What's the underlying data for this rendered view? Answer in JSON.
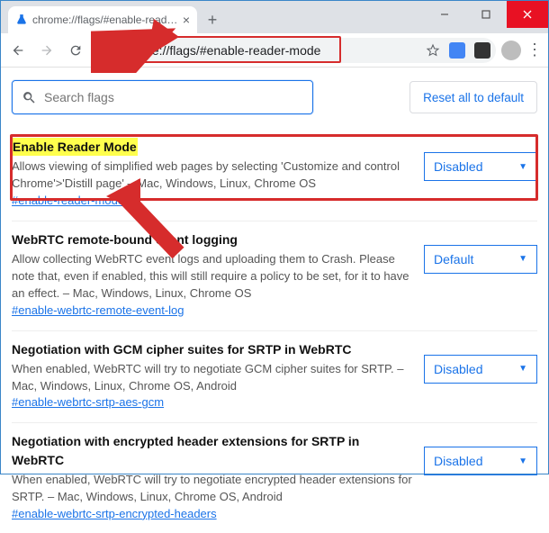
{
  "window": {
    "tab_title": "chrome://flags/#enable-reader-m",
    "url": "chrome://flags/#enable-reader-mode"
  },
  "toolbar": {
    "reset_label": "Reset all to default",
    "search_placeholder": "Search flags"
  },
  "flags": [
    {
      "title": "Enable Reader Mode",
      "highlighted": true,
      "desc": "Allows viewing of simplified web pages by selecting 'Customize and control Chrome'>'Distill page' – Mac, Windows, Linux, Chrome OS",
      "anchor": "#enable-reader-mode",
      "value": "Disabled"
    },
    {
      "title": "WebRTC remote-bound event logging",
      "highlighted": false,
      "desc": "Allow collecting WebRTC event logs and uploading them to Crash. Please note that, even if enabled, this will still require a policy to be set, for it to have an effect. – Mac, Windows, Linux, Chrome OS",
      "anchor": "#enable-webrtc-remote-event-log",
      "value": "Default"
    },
    {
      "title": "Negotiation with GCM cipher suites for SRTP in WebRTC",
      "highlighted": false,
      "desc": "When enabled, WebRTC will try to negotiate GCM cipher suites for SRTP. – Mac, Windows, Linux, Chrome OS, Android",
      "anchor": "#enable-webrtc-srtp-aes-gcm",
      "value": "Disabled"
    },
    {
      "title": "Negotiation with encrypted header extensions for SRTP in WebRTC",
      "highlighted": false,
      "desc": "When enabled, WebRTC will try to negotiate encrypted header extensions for SRTP. – Mac, Windows, Linux, Chrome OS, Android",
      "anchor": "#enable-webrtc-srtp-encrypted-headers",
      "value": "Disabled"
    }
  ]
}
